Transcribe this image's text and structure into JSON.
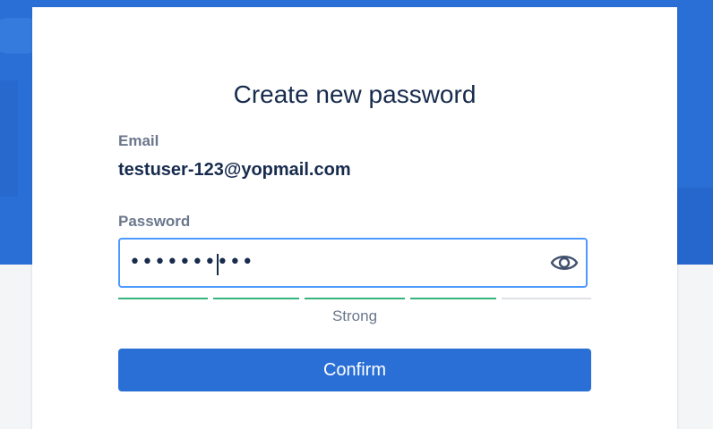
{
  "form": {
    "title": "Create new password",
    "email_label": "Email",
    "email_value": "testuser-123@yopmail.com",
    "password_label": "Password",
    "password_value": "••••••••••",
    "strength": {
      "label": "Strong",
      "filled_segments": 4,
      "total_segments": 5
    },
    "confirm_label": "Confirm"
  },
  "colors": {
    "accent": "#2a6fd6",
    "focus_border": "#4c9aff",
    "strength_filled": "#36b37e",
    "strength_empty": "#dfe1e6",
    "text_primary": "#172b4d",
    "text_muted": "#6b778c"
  },
  "icons": {
    "visibility_toggle": "eye-icon"
  }
}
